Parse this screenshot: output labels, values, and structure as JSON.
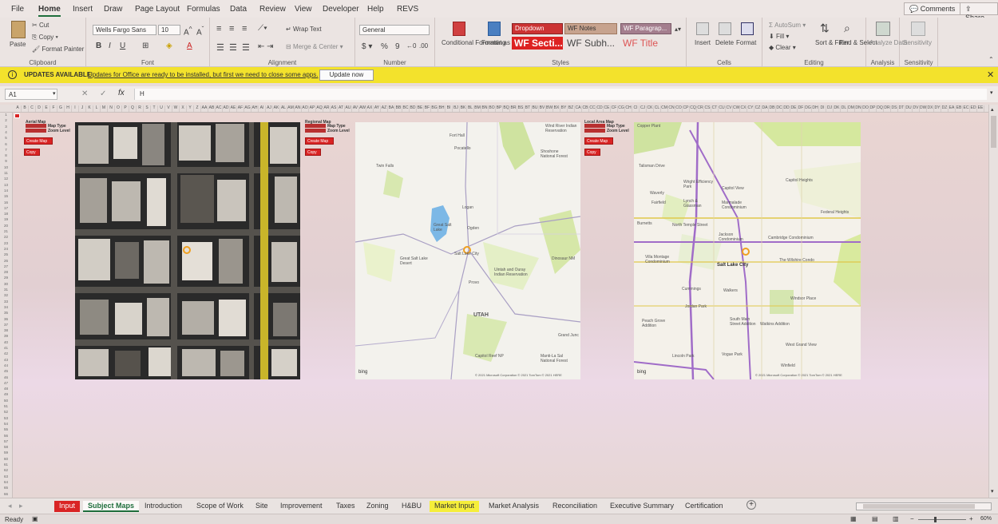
{
  "menu": {
    "items": [
      "File",
      "Home",
      "Insert",
      "Draw",
      "Page Layout",
      "Formulas",
      "Data",
      "Review",
      "View",
      "Developer",
      "Help",
      "REVS"
    ],
    "active": "Home",
    "comments": "Comments",
    "share": "Share"
  },
  "ribbon": {
    "clipboard": {
      "label": "Clipboard",
      "paste": "Paste",
      "cut": "Cut",
      "copy": "Copy",
      "format_painter": "Format Painter"
    },
    "font": {
      "label": "Font",
      "name": "Wells Fargo Sans",
      "size": "10"
    },
    "alignment": {
      "label": "Alignment",
      "wrap_text": "Wrap Text",
      "merge_center": "Merge & Center"
    },
    "number": {
      "label": "Number",
      "format": "General"
    },
    "styles": {
      "label": "Styles",
      "conditional": "Conditional Formatting",
      "format_table": "Format as Table",
      "dropdown": "Dropdown",
      "wf_section": "WF Secti...",
      "wf_notes": "WF Notes",
      "wf_subh": "WF Subh...",
      "wf_paragraph": "WF Paragrap...",
      "wf_title": "WF Title"
    },
    "cells": {
      "label": "Cells",
      "insert": "Insert",
      "delete": "Delete",
      "format": "Format"
    },
    "editing": {
      "label": "Editing",
      "autosum": "AutoSum",
      "fill": "Fill",
      "clear": "Clear",
      "sort_filter": "Sort & Filter",
      "find_select": "Find & Select"
    },
    "analysis": {
      "label": "Analysis",
      "analyze": "Analyze Data"
    },
    "sensitivity": {
      "label": "Sensitivity",
      "sensitivity": "Sensitivity"
    }
  },
  "update": {
    "title": "UPDATES AVAILABLE",
    "message": "Updates for Office are ready to be installed, but first we need to close some apps.",
    "button": "Update now"
  },
  "formula": {
    "cell_ref": "A1",
    "content": "H"
  },
  "columns": [
    "A",
    "B",
    "C",
    "D",
    "E",
    "F",
    "G",
    "H",
    "I",
    "J",
    "K",
    "L",
    "M",
    "N",
    "O",
    "P",
    "Q",
    "R",
    "S",
    "T",
    "U",
    "V",
    "W",
    "X",
    "Y",
    "Z",
    "AA",
    "AB",
    "AC",
    "AD",
    "AE",
    "AF",
    "AG",
    "AH",
    "AI",
    "AJ",
    "AK",
    "AL",
    "AM",
    "AN",
    "AO",
    "AP",
    "AQ",
    "AR",
    "AS",
    "AT",
    "AU",
    "AV",
    "AW",
    "AX",
    "AY",
    "AZ",
    "BA",
    "BB",
    "BC",
    "BD",
    "BE",
    "BF",
    "BG",
    "BH",
    "BI",
    "BJ",
    "BK",
    "BL",
    "BM",
    "BN",
    "BO",
    "BP",
    "BQ",
    "BR",
    "BS",
    "BT",
    "BU",
    "BV",
    "BW",
    "BX",
    "BY",
    "BZ",
    "CA",
    "CB",
    "CC",
    "CD",
    "CE",
    "CF",
    "CG",
    "CH",
    "CI",
    "CJ",
    "CK",
    "CL",
    "CM",
    "CN",
    "CO",
    "CP",
    "CQ",
    "CR",
    "CS",
    "CT",
    "CU",
    "CV",
    "CW",
    "CX",
    "CY",
    "CZ",
    "DA",
    "DB",
    "DC",
    "DD",
    "DE",
    "DF",
    "DG",
    "DH",
    "DI",
    "DJ",
    "DK",
    "DL",
    "DM",
    "DN",
    "DO",
    "DP",
    "DQ",
    "DR",
    "DS",
    "DT",
    "DU",
    "DV",
    "DW",
    "DX",
    "DY",
    "DZ",
    "EA",
    "EB",
    "EC",
    "ED",
    "EE"
  ],
  "sheet": {
    "aerial": {
      "title": "Aerial Map",
      "map_type": "Map Type",
      "zoom": "Zoom Level",
      "create": "Create Map",
      "copy": "Copy"
    },
    "regional": {
      "title": "Regional Map",
      "map_type": "Map Type",
      "zoom": "Zoom Level",
      "create": "Create Map",
      "copy": "Copy"
    },
    "local": {
      "title": "Local Area Map",
      "map_type": "Map Type",
      "zoom": "Zoom Level",
      "create": "Create Map",
      "copy": "Copy"
    },
    "regional_labels": [
      "Fort Hall",
      "Pocatello",
      "Wind River Indian Reservation",
      "Shoshone National Forest",
      "Twin Falls",
      "Logan",
      "Great Salt Lake",
      "Ogden",
      "Salt Lake City",
      "Great Salt Lake Desert",
      "Provo",
      "Uintah and Ouray Indian Reservation",
      "Dinosaur NM",
      "UTAH",
      "Grand Junc",
      "Capitol Reef NP",
      "Manti-La Sal National Forest"
    ],
    "local_labels": [
      "Copper Plant",
      "Talisman Drive",
      "Waverly",
      "Fairfield",
      "Wright Efficiency Park",
      "Lynch & Glassman",
      "Capitol View",
      "Marmalade Condominium",
      "Capitol Heights",
      "Federal Heights",
      "Burnetts",
      "North Temple Street",
      "Jackson Condominium",
      "Cambridge Condominium",
      "Villa Montage Condominium",
      "Salt Lake City",
      "The Wilshire Condo",
      "Windsor Place",
      "Jordan Park",
      "Walkers",
      "Cummings",
      "Peach Grove Addition",
      "South Main Street Addition",
      "Watkins Addition",
      "Lincoln Park",
      "Vogue Park",
      "West Grand View",
      "Winfield"
    ],
    "map_credit": "© 2021 Microsoft Corporation © 2021 TomTom © 2021 HERE",
    "bing": "bing"
  },
  "tabs": [
    {
      "label": "Input",
      "style": "red"
    },
    {
      "label": "Subject Maps",
      "style": "active"
    },
    {
      "label": "Introduction",
      "style": "normal"
    },
    {
      "label": "Scope of Work",
      "style": "normal"
    },
    {
      "label": "Site",
      "style": "normal"
    },
    {
      "label": "Improvement",
      "style": "normal"
    },
    {
      "label": "Taxes",
      "style": "normal"
    },
    {
      "label": "Zoning",
      "style": "normal"
    },
    {
      "label": "H&BU",
      "style": "normal"
    },
    {
      "label": "Market Input",
      "style": "yellow"
    },
    {
      "label": "Market Analysis",
      "style": "normal"
    },
    {
      "label": "Reconciliation",
      "style": "normal"
    },
    {
      "label": "Executive Summary",
      "style": "normal"
    },
    {
      "label": "Certification",
      "style": "normal"
    }
  ],
  "status": {
    "ready": "Ready",
    "zoom": "60%"
  },
  "colors": {
    "accent": "#1e6e3c",
    "red_button": "#d92424",
    "update_bar": "#f3e22c",
    "market_tab": "#f5ee3a"
  }
}
